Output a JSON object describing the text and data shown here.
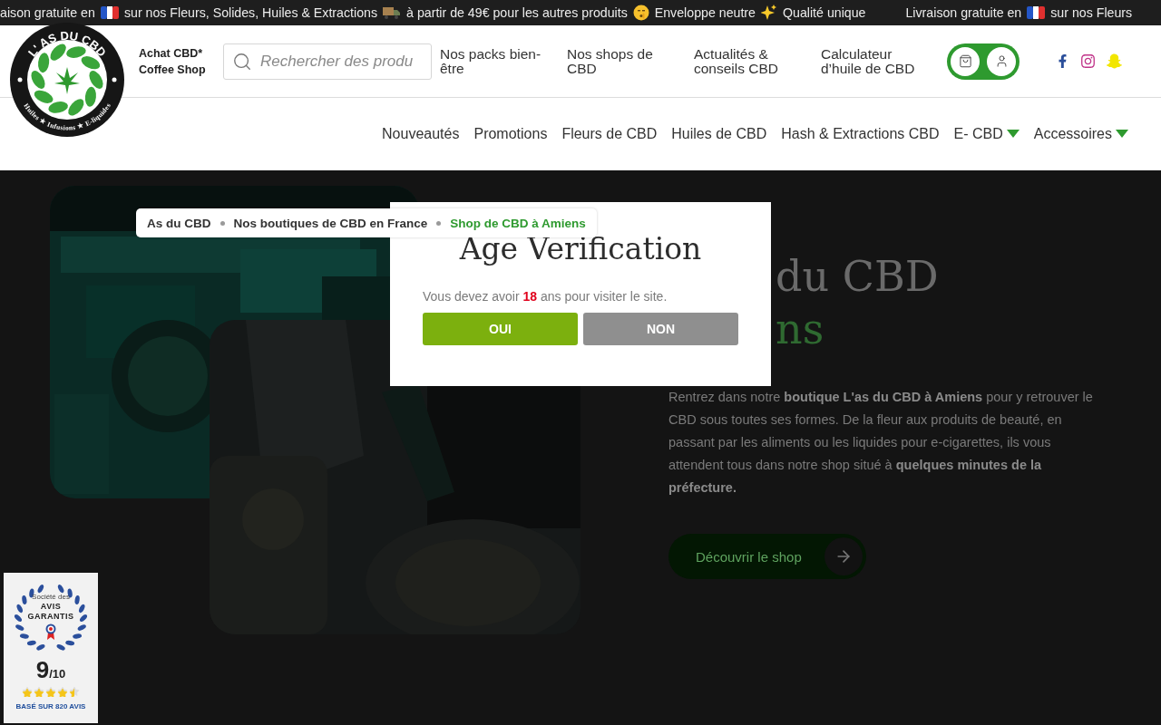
{
  "announcement_bar": {
    "groups": [
      [
        {
          "kind": "text",
          "text": "aison gratuite en"
        },
        {
          "kind": "flag"
        },
        {
          "kind": "text",
          "text": "sur nos Fleurs, Solides, Huiles & Extractions"
        },
        {
          "kind": "truck"
        },
        {
          "kind": "text",
          "text": "à partir de 49€ pour les autres produits"
        },
        {
          "kind": "face"
        },
        {
          "kind": "text",
          "text": "Enveloppe neutre"
        },
        {
          "kind": "sparkles"
        },
        {
          "kind": "text",
          "text": "Qualité unique"
        }
      ],
      [
        {
          "kind": "text",
          "text": "Livraison gratuite en"
        },
        {
          "kind": "flag"
        },
        {
          "kind": "text",
          "text": "sur nos Fleurs"
        }
      ]
    ]
  },
  "header": {
    "logo": {
      "title": "L' AS DU CBD",
      "tagline": "Huiles ★ Infusions ★ E-liquides"
    },
    "brand_lines": [
      "Achat CBD*",
      "Coffee Shop"
    ],
    "search": {
      "placeholder": "Rechercher des produ"
    },
    "top_links": [
      "Nos packs bien-être",
      "Nos shops de CBD",
      "Actualités & conseils CBD",
      "Calculateur d’huile de CBD"
    ],
    "main_nav": [
      {
        "label": "Nouveautés",
        "has_dropdown": false
      },
      {
        "label": "Promotions",
        "has_dropdown": false
      },
      {
        "label": "Fleurs de CBD",
        "has_dropdown": false
      },
      {
        "label": "Huiles de CBD",
        "has_dropdown": false
      },
      {
        "label": "Hash & Extractions CBD",
        "has_dropdown": false
      },
      {
        "label": "E- CBD",
        "has_dropdown": true
      },
      {
        "label": "Accessoires",
        "has_dropdown": true
      }
    ]
  },
  "hero": {
    "heading_lines": [
      {
        "text": "du CBD",
        "accent": false
      },
      {
        "text": "ns",
        "accent": true
      }
    ],
    "paragraph": "Rentrez dans notre **boutique L'as du CBD à Amiens** pour y retrouver le CBD sous toutes ses formes. De la fleur aux produits de beauté, en passant par les aliments ou les liquides pour e-cigarettes, ils vous attendent tous dans notre shop situé à **quelques minutes de la préfecture.**",
    "button": "Découvrir le shop"
  },
  "breadcrumb": [
    {
      "label": "As du CBD",
      "current": false
    },
    {
      "label": "Nos boutiques de CBD en France",
      "current": false
    },
    {
      "label": "Shop de CBD à Amiens",
      "current": true
    }
  ],
  "age_modal": {
    "title": "Age Verification",
    "message": "Vous devez avoir **18** ans pour visiter le site.",
    "buttons": [
      {
        "label": "OUI",
        "kind": "confirm"
      },
      {
        "label": "NON",
        "kind": "decline"
      }
    ]
  },
  "reviews_badge": {
    "top_line": "Société des",
    "name_lines": [
      "AVIS",
      "GARANTIS"
    ],
    "score": "9",
    "scale": "/10",
    "stars": 4.5,
    "footer": "BASÉ SUR 820 AVIS"
  }
}
